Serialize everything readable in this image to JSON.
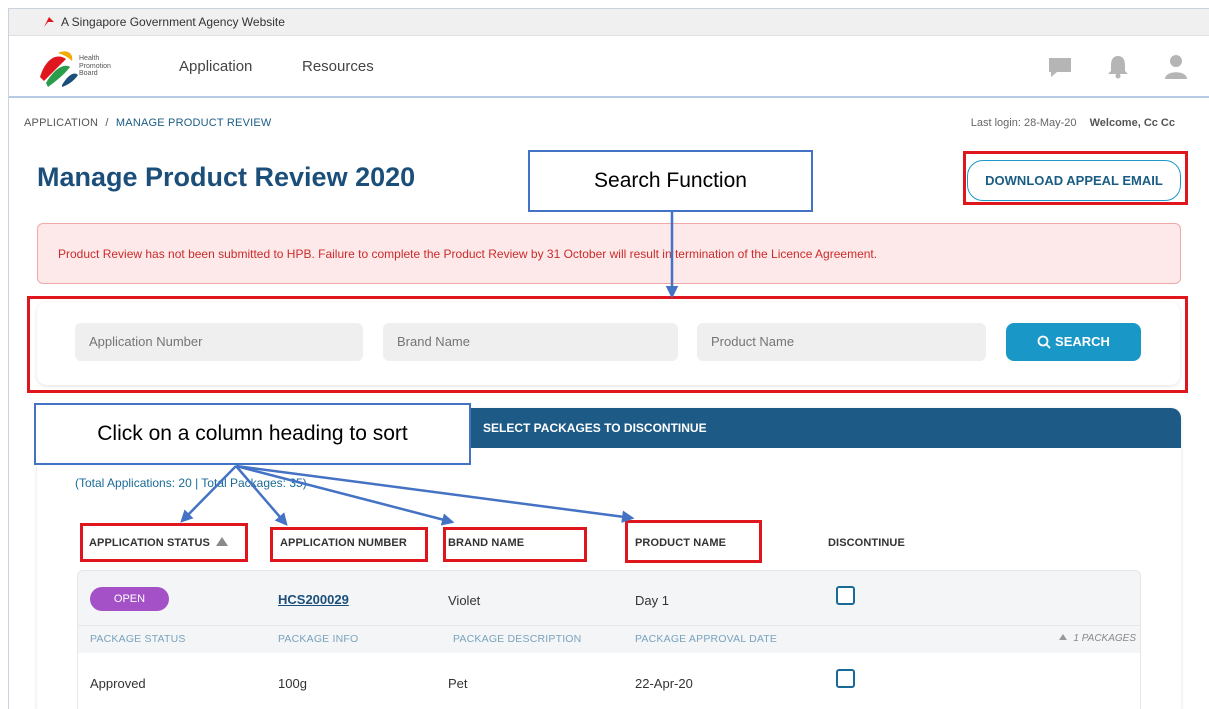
{
  "gov_banner": {
    "text": "A Singapore Government Agency Website"
  },
  "header": {
    "logo_text": [
      "Health",
      "Promotion",
      "Board"
    ],
    "nav": [
      {
        "label": "Application"
      },
      {
        "label": "Resources"
      }
    ],
    "icons": [
      "chat-icon",
      "bell-icon",
      "user-icon"
    ]
  },
  "breadcrumb": {
    "root": "APPLICATION",
    "separator": "/",
    "current": "MANAGE PRODUCT REVIEW"
  },
  "session": {
    "last_login": "Last login: 28-May-20",
    "welcome": "Welcome, Cc Cc"
  },
  "page": {
    "title": "Manage Product Review 2020",
    "download_button": "DOWNLOAD APPEAL EMAIL",
    "alert": "Product Review has not been submitted to HPB. Failure to complete the Product Review by 31 October will result in termination of the Licence Agreement."
  },
  "search": {
    "application_number_placeholder": "Application Number",
    "brand_name_placeholder": "Brand Name",
    "product_name_placeholder": "Product Name",
    "button_label": "SEARCH"
  },
  "table": {
    "tab_label": "SELECT PACKAGES TO DISCONTINUE",
    "totals": "(Total Applications: 20 | Total Packages: 35)",
    "columns": {
      "status": "APPLICATION STATUS",
      "number": "APPLICATION NUMBER",
      "brand": "BRAND NAME",
      "product": "PRODUCT NAME",
      "discontinue": "DISCONTINUE"
    },
    "rows": [
      {
        "status": "OPEN",
        "number": "HCS200029",
        "brand": "Violet",
        "product": "Day 1",
        "package_columns": {
          "status": "PACKAGE STATUS",
          "info": "PACKAGE INFO",
          "description": "PACKAGE DESCRIPTION",
          "approval_date": "PACKAGE APPROVAL DATE"
        },
        "package_count": "1 PACKAGES",
        "packages": [
          {
            "status": "Approved",
            "info": "100g",
            "description": "Pet",
            "approval_date": "22-Apr-20"
          }
        ]
      }
    ]
  },
  "annotations": {
    "search_function": "Search Function",
    "sort_hint": "Click on a column heading to sort"
  },
  "colors": {
    "primary": "#1b4f7a",
    "accent": "#1997c6",
    "alert_text": "#cc2b2b",
    "status_open": "#a451c7",
    "annotation_red": "#e0161e",
    "annotation_blue": "#4472c4"
  }
}
